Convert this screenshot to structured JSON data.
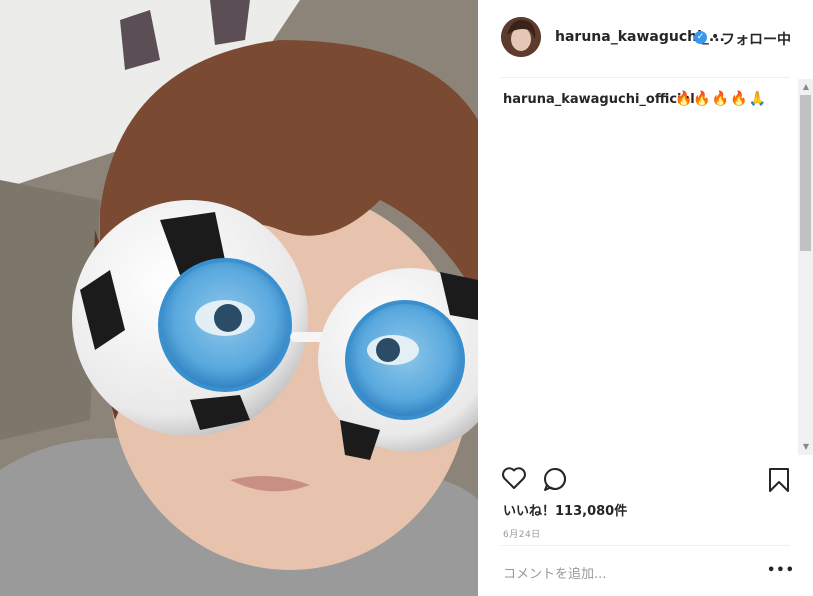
{
  "post": {
    "username_short": "haruna_kawaguchi_...",
    "verified_icon": "verified-badge-icon",
    "separator": "•",
    "follow_label": "フォロー中",
    "caption_user": "haruna_kawaguchi_official",
    "caption_text": "🔥🔥🔥🔥🙏",
    "likes_label": "いいね！",
    "likes_count": "113,080件",
    "date": "6月24日",
    "comment_placeholder": "コメントを追加...",
    "more_label": "•••"
  },
  "icons": {
    "like": "heart-icon",
    "comment": "comment-bubble-icon",
    "save": "bookmark-icon",
    "scroll_up": "▲",
    "scroll_down": "▼"
  },
  "colors": {
    "verified": "#3897f0",
    "text": "#262626",
    "muted": "#999999",
    "divider": "#efefef"
  }
}
